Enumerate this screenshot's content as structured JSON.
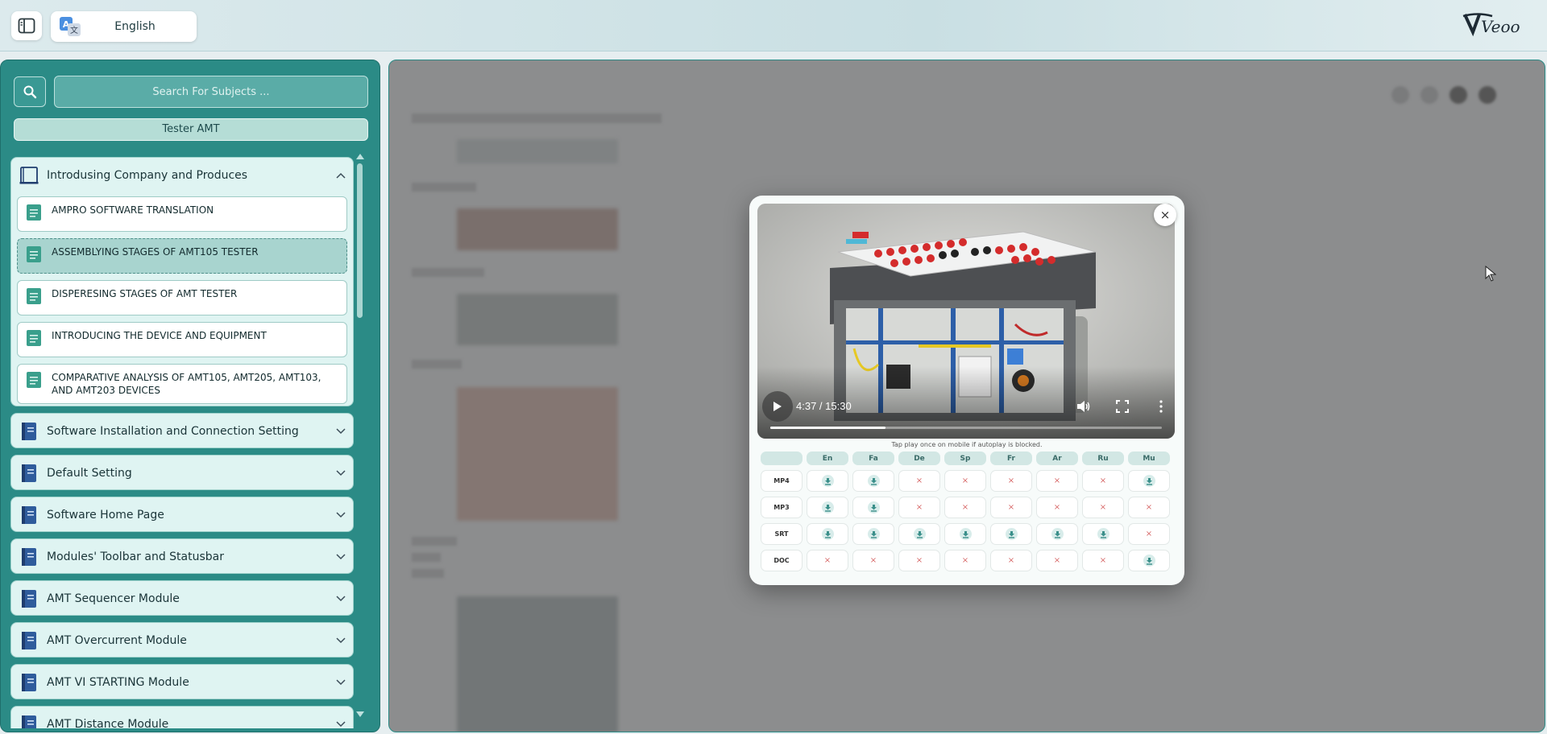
{
  "header": {
    "language": "English",
    "logo_text": "Veoo"
  },
  "sidebar": {
    "search_placeholder": "Search For Subjects ...",
    "subject": "Tester AMT",
    "sections": [
      {
        "title": "Introdusing Company and Produces",
        "expanded": true,
        "lessons": [
          {
            "title": "AMPRO SOFTWARE TRANSLATION",
            "active": false
          },
          {
            "title": "ASSEMBLYING STAGES OF AMT105 TESTER",
            "active": true
          },
          {
            "title": "DISPERESING STAGES OF AMT TESTER",
            "active": false
          },
          {
            "title": "INTRODUCING THE DEVICE AND EQUIPMENT",
            "active": false
          },
          {
            "title": "COMPARATIVE ANALYSIS OF AMT105, AMT205, AMT103, AND AMT203 DEVICES",
            "active": false
          }
        ]
      },
      {
        "title": "Software Installation and Connection Setting"
      },
      {
        "title": "Default Setting"
      },
      {
        "title": "Software Home Page"
      },
      {
        "title": "Modules' Toolbar and Statusbar"
      },
      {
        "title": "AMT Sequencer Module"
      },
      {
        "title": "AMT Overcurrent Module"
      },
      {
        "title": "AMT VI STARTING Module"
      },
      {
        "title": "AMT Distance Module"
      }
    ]
  },
  "modal": {
    "close_label": "×",
    "video": {
      "time": "4:37 / 15:30",
      "progress": 0.295
    },
    "hint": "Tap play once on mobile if autoplay is blocked.",
    "languages": [
      "En",
      "Fa",
      "De",
      "Sp",
      "Fr",
      "Ar",
      "Ru",
      "Mu"
    ],
    "formats": [
      {
        "label": "MP4",
        "available": [
          true,
          true,
          false,
          false,
          false,
          false,
          false,
          true
        ]
      },
      {
        "label": "MP3",
        "available": [
          true,
          true,
          false,
          false,
          false,
          false,
          false,
          false
        ]
      },
      {
        "label": "SRT",
        "available": [
          true,
          true,
          true,
          true,
          true,
          true,
          true,
          false
        ]
      },
      {
        "label": "DOC",
        "available": [
          false,
          false,
          false,
          false,
          false,
          false,
          false,
          true
        ]
      }
    ],
    "unavailable_glyph": "×"
  },
  "colors": {
    "sidebar_bg": "#2b8b86",
    "accent": "#3a8f8a",
    "unavailable": "#d86a6a"
  }
}
